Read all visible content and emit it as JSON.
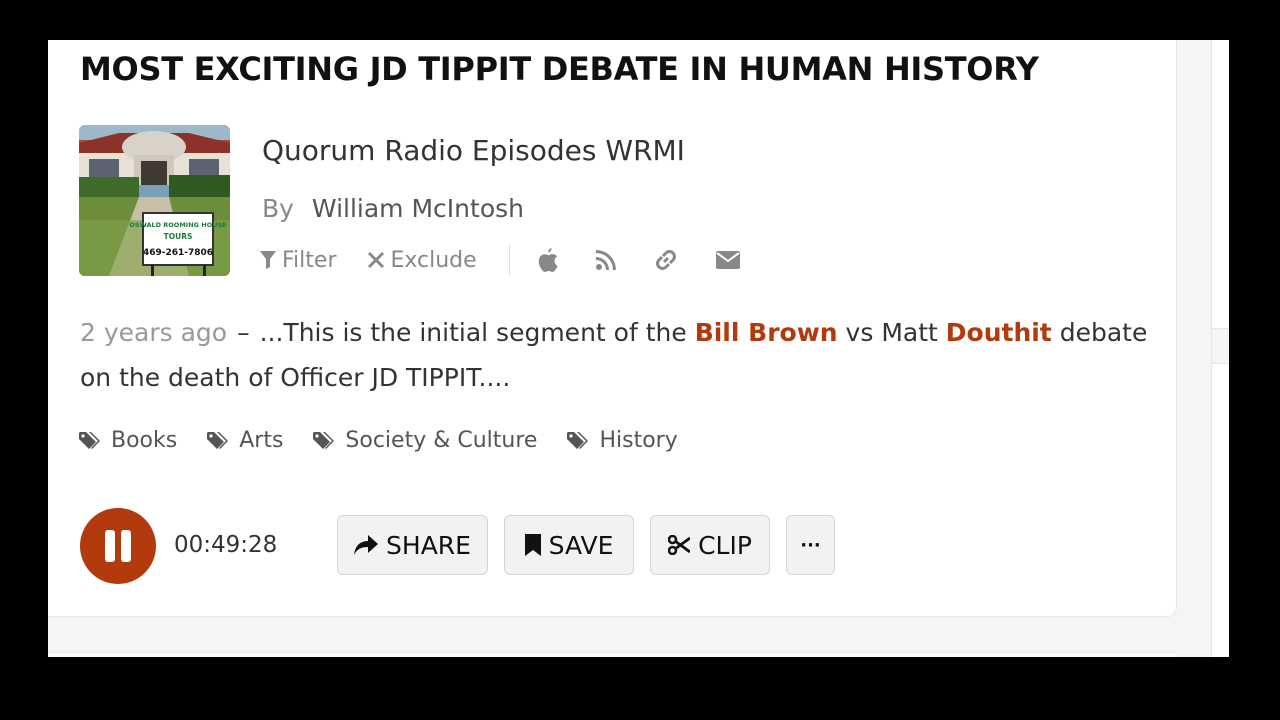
{
  "episode": {
    "title": "MOST EXCITING JD TIPPIT DEBATE IN HUMAN HISTORY",
    "podcast_name": "Quorum Radio Episodes WRMI",
    "by_label": "By",
    "author": "William McIntosh",
    "thumbnail_sign": {
      "line1": "OSWALD ROOMING HOUSE",
      "line2": "TOURS",
      "line3": "469-261-7806"
    }
  },
  "tools": {
    "filter_label": "Filter",
    "exclude_label": "Exclude",
    "icons": [
      "apple-icon",
      "rss-icon",
      "link-icon",
      "email-icon"
    ]
  },
  "description": {
    "time_ago": "2 years ago",
    "separator": "–",
    "text_1": "...This is the initial segment of the ",
    "highlight_1": "Bill Brown",
    "text_2": " vs Matt ",
    "highlight_2": "Douthit",
    "text_3": " debate on the death of Officer JD TIPPIT...."
  },
  "tags": [
    {
      "label": "Books"
    },
    {
      "label": "Arts"
    },
    {
      "label": "Society & Culture"
    },
    {
      "label": "History"
    }
  ],
  "player": {
    "state": "playing",
    "timecode": "00:49:28"
  },
  "actions": {
    "share_label": "SHARE",
    "save_label": "SAVE",
    "clip_label": "CLIP",
    "more_label": "···"
  },
  "colors": {
    "accent": "#b23a0c",
    "background": "#000000",
    "card": "#ffffff"
  }
}
